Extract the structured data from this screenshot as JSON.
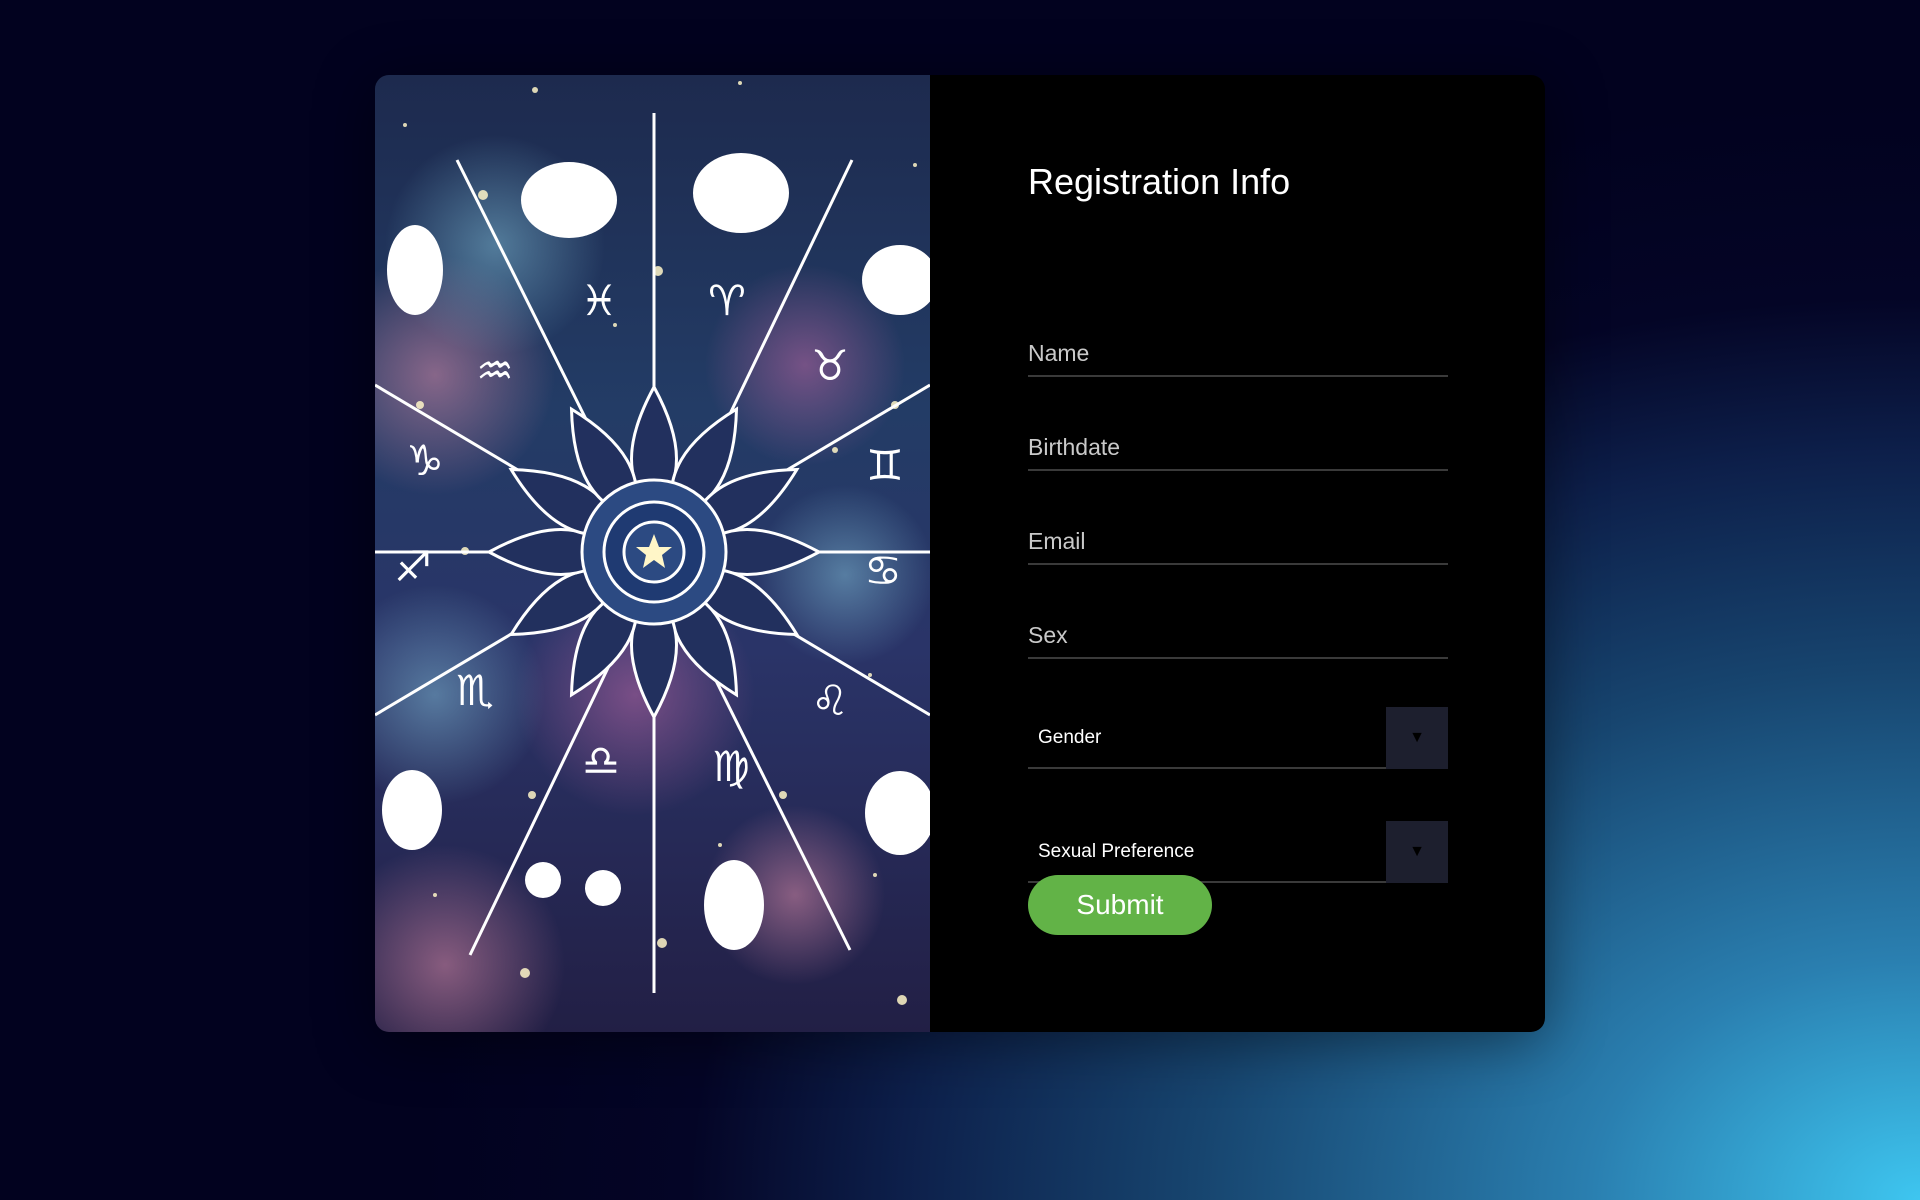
{
  "form": {
    "title": "Registration Info",
    "name_placeholder": "Name",
    "birthdate_placeholder": "Birthdate",
    "email_placeholder": "Email",
    "sex_placeholder": "Sex",
    "gender_select": {
      "selected": "Gender",
      "arrow": "▼"
    },
    "preference_select": {
      "selected": "Sexual Preference",
      "arrow": "▼"
    },
    "submit_label": "Submit"
  },
  "art": {
    "description_icon": "zodiac-wheel-icon"
  },
  "colors": {
    "submit": "#62b347",
    "panel": "#000000",
    "select_arrow_bg": "#1d1f2e"
  }
}
